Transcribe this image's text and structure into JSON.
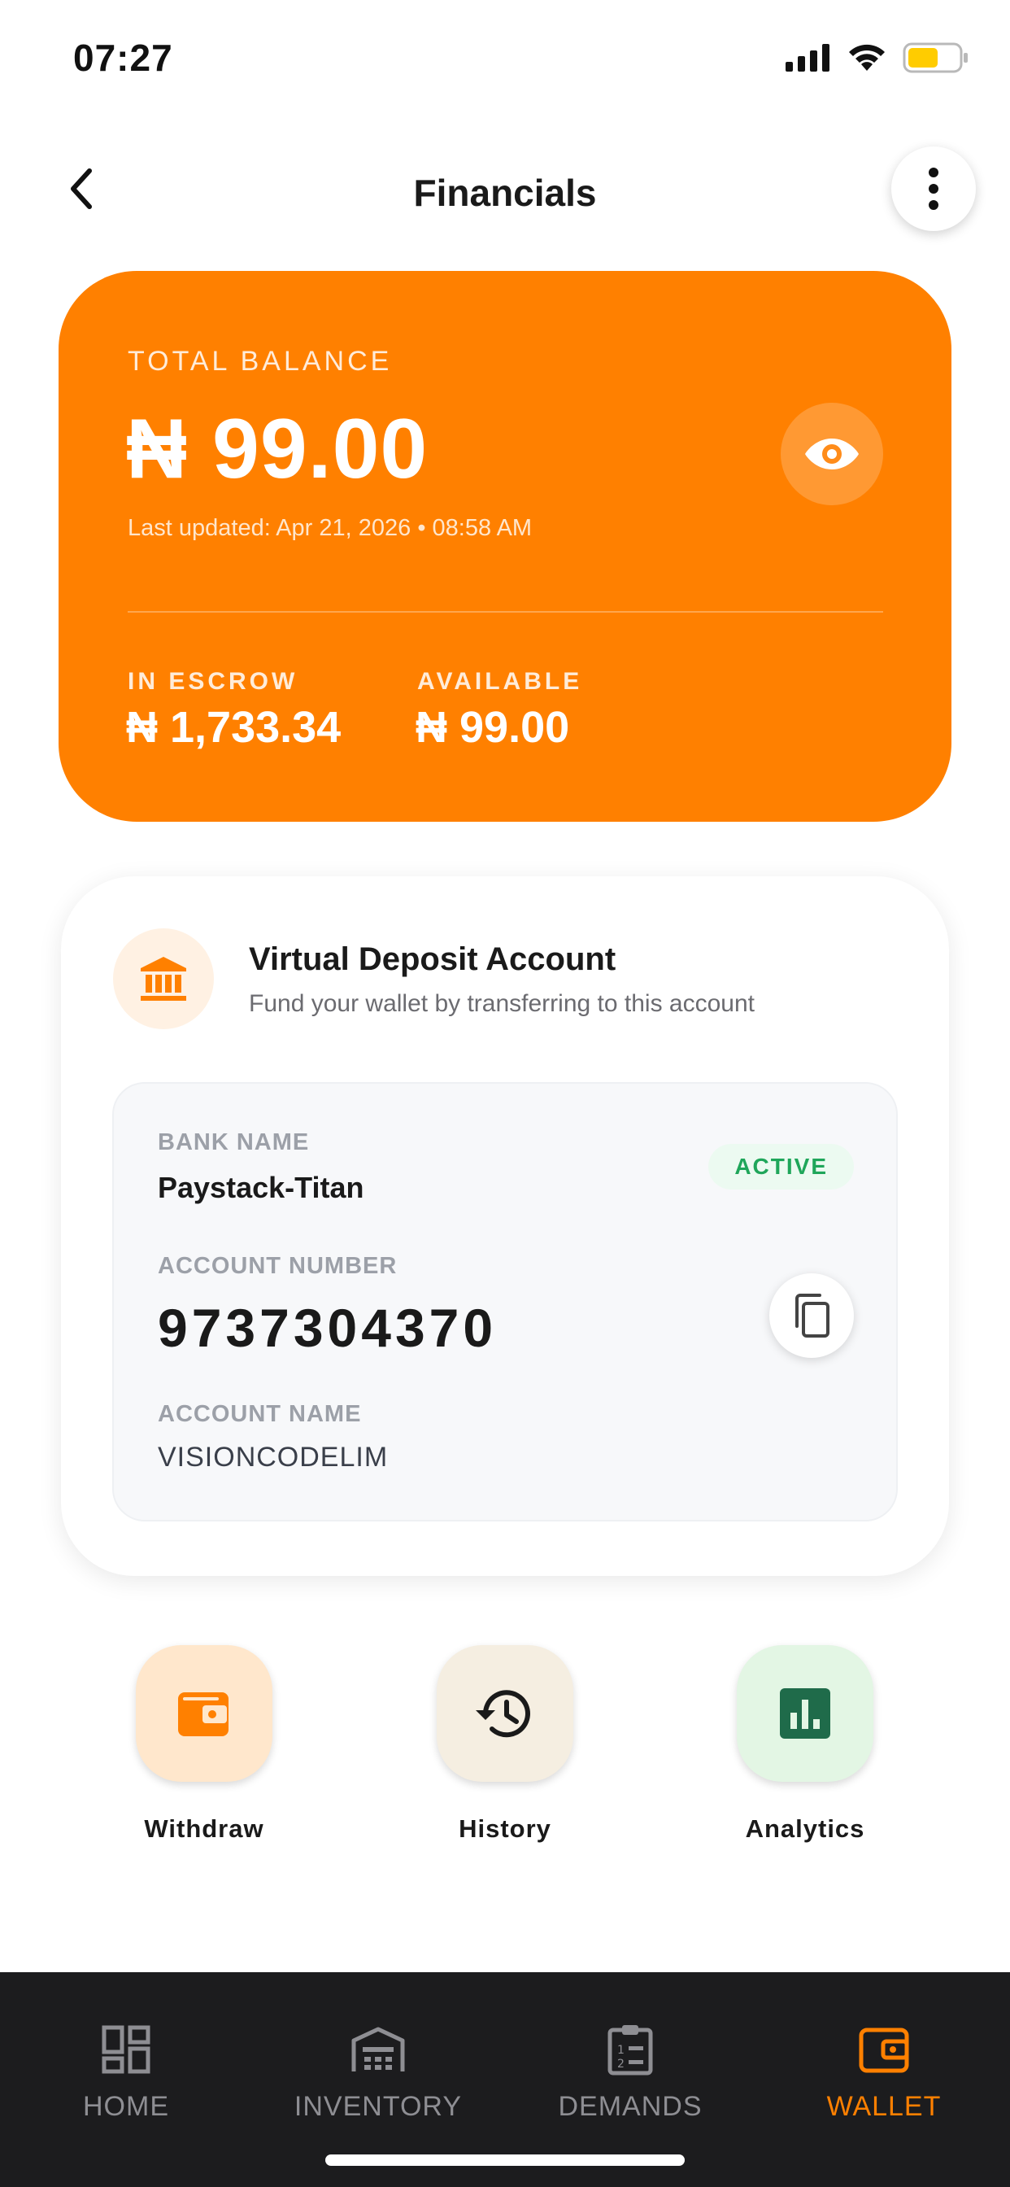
{
  "status_bar": {
    "time": "07:27",
    "icons": [
      "signal-icon",
      "wifi-icon",
      "battery-icon"
    ]
  },
  "header": {
    "title": "Financials",
    "back_icon": "chevron-left-icon",
    "menu_icon": "more-vertical-icon"
  },
  "balance": {
    "label": "TOTAL BALANCE",
    "amount": "₦ 99.00",
    "last_updated": "Last updated: Apr 21, 2026 • 08:58 AM",
    "eye_icon": "eye-icon",
    "escrow_label": "IN ESCROW",
    "escrow_value": "₦ 1,733.34",
    "available_label": "AVAILABLE",
    "available_value": "₦ 99.00",
    "card_color": "#FF8000"
  },
  "virtual_account": {
    "title": "Virtual Deposit Account",
    "subtitle": "Fund your wallet by transferring to this account",
    "bank_icon": "bank-icon",
    "bank_name_label": "BANK NAME",
    "bank_name": "Paystack-Titan",
    "status": "ACTIVE",
    "account_number_label": "ACCOUNT NUMBER",
    "account_number": "9737304370",
    "account_name_label": "ACCOUNT NAME",
    "account_name": "VISIONCODELIM",
    "copy_icon": "copy-icon"
  },
  "actions": [
    {
      "label": "Withdraw",
      "icon": "wallet-icon",
      "bg": "#FFE7CC",
      "fg": "#FF8000"
    },
    {
      "label": "History",
      "icon": "history-icon",
      "bg": "#F5EEE1",
      "fg": "#1a1a1a"
    },
    {
      "label": "Analytics",
      "icon": "bar-chart-icon",
      "bg": "#E3F6E4",
      "fg": "#1F6B4A"
    }
  ],
  "nav": [
    {
      "label": "HOME",
      "icon": "dashboard-icon",
      "active": false
    },
    {
      "label": "INVENTORY",
      "icon": "warehouse-icon",
      "active": false
    },
    {
      "label": "DEMANDS",
      "icon": "clipboard-list-icon",
      "active": false
    },
    {
      "label": "WALLET",
      "icon": "wallet-icon",
      "active": true
    }
  ],
  "colors": {
    "accent": "#FF8000",
    "active_green": "#1FA65A",
    "nav_bg": "#1C1C1E"
  }
}
